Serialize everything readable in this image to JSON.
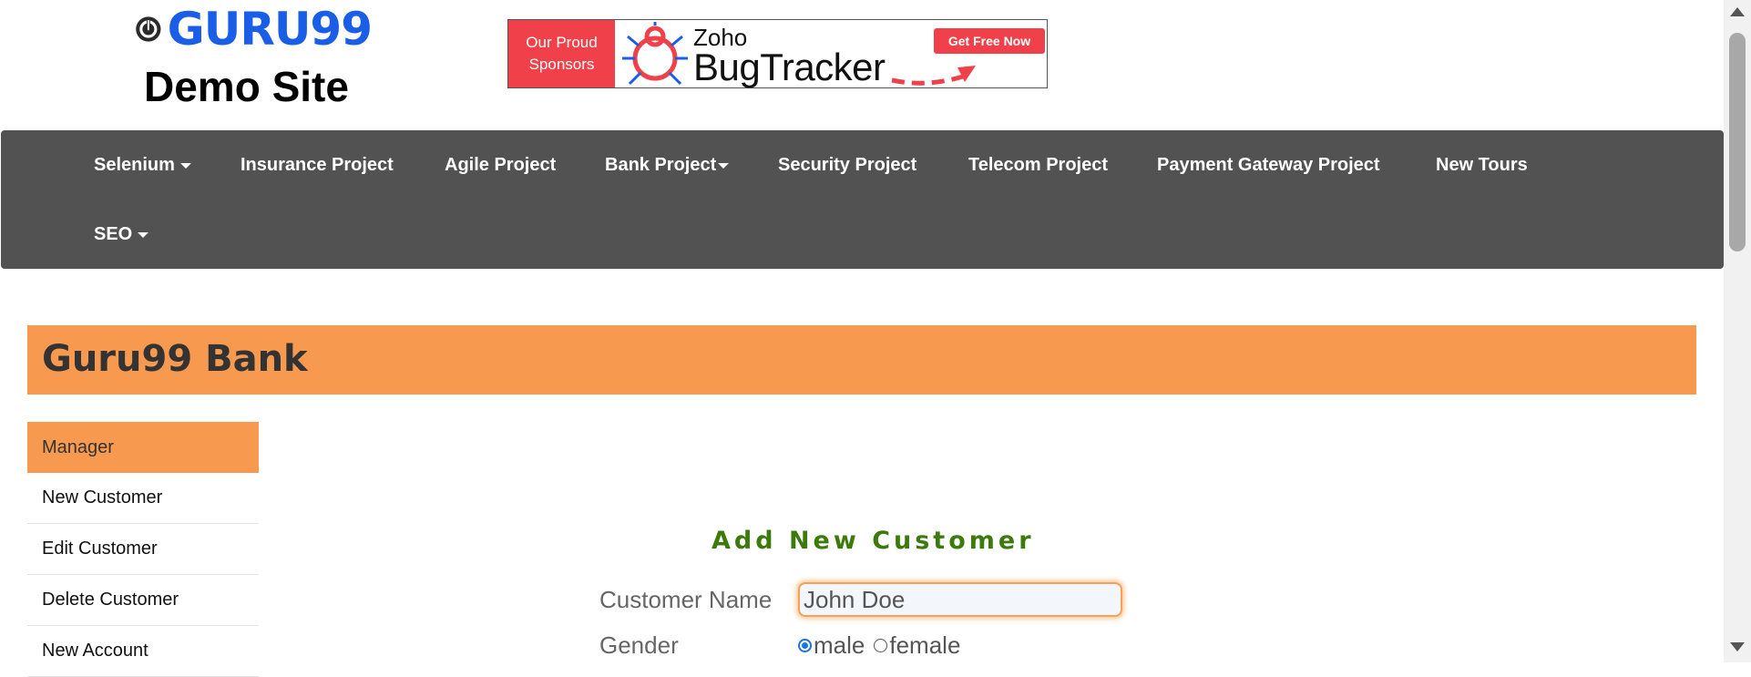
{
  "header": {
    "logo_text": "GURU99",
    "subtitle": "Demo Site"
  },
  "ad": {
    "left_line1": "Our Proud",
    "left_line2": "Sponsors",
    "brand_small": "Zoho",
    "brand_large": "BugTracker",
    "cta": "Get Free Now"
  },
  "nav": {
    "items": [
      {
        "label": "Selenium",
        "dropdown": true
      },
      {
        "label": "Insurance Project",
        "dropdown": false
      },
      {
        "label": "Agile Project",
        "dropdown": false
      },
      {
        "label": "Bank Project",
        "dropdown": true
      },
      {
        "label": "Security Project",
        "dropdown": false
      },
      {
        "label": "Telecom Project",
        "dropdown": false
      },
      {
        "label": "Payment Gateway Project",
        "dropdown": false
      },
      {
        "label": "New Tours",
        "dropdown": false
      },
      {
        "label": "SEO",
        "dropdown": true
      }
    ]
  },
  "bank": {
    "title": "Guru99 Bank"
  },
  "sidebar": {
    "items": [
      {
        "label": "Manager",
        "active": true
      },
      {
        "label": "New Customer",
        "active": false
      },
      {
        "label": "Edit Customer",
        "active": false
      },
      {
        "label": "Delete Customer",
        "active": false
      },
      {
        "label": "New Account",
        "active": false
      }
    ]
  },
  "form": {
    "title": "Add New Customer",
    "customer_name_label": "Customer Name",
    "customer_name_value": "John Doe",
    "gender_label": "Gender",
    "gender_options": [
      "male",
      "female"
    ],
    "gender_selected": "male"
  },
  "colors": {
    "brand_blue": "#1a5ee8",
    "nav_bg": "#525252",
    "accent_orange": "#f79a4f",
    "form_title_green": "#3d7a0c",
    "ad_red": "#f0404a"
  },
  "icons": {
    "logo": "guru99-logo-icon",
    "ad_bug": "bug-icon",
    "ad_arrow": "dashed-arrow-icon"
  }
}
